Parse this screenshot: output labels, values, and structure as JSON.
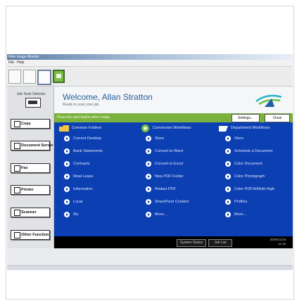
{
  "window": {
    "title": "Web Image Monitor",
    "menu": [
      "File",
      "Help"
    ]
  },
  "sidebar": {
    "title": "Job Tools Selector",
    "buttons": [
      "Copy",
      "Document Server",
      "Fax",
      "Printer",
      "Scanner",
      "Other Function"
    ]
  },
  "header": {
    "welcome": "Welcome, Allan Stratton",
    "subtitle": "Ready to scan your job."
  },
  "bar": {
    "message": "Press the start button when ready.",
    "settings": "Settings...",
    "close": "Close"
  },
  "columns": [
    {
      "title": "Common Folders",
      "items": [
        "Current Desktop",
        "Bank Statements",
        "Contracts",
        "Meal Lease",
        "Information",
        "Local",
        "My"
      ]
    },
    {
      "title": "Conversion Workflows",
      "items": [
        "Store",
        "Convert to Word",
        "Convert to Excel",
        "New PDF Folder",
        "Redact PDF",
        "SharePoint Content",
        "More..."
      ]
    },
    {
      "title": "Department Workflows",
      "items": [
        "Store",
        "Schedule a Document",
        "Color Document",
        "Color Photograph",
        "Color PDF/A/Multi High",
        "Profiles",
        "More..."
      ]
    }
  ],
  "status": {
    "system_status": "System Status",
    "job_list": "Job List",
    "date": "2009/11/18",
    "time": "11:18"
  },
  "colors": {
    "accent_blue": "#0c3fb2",
    "bar_green": "#7bb23d",
    "title_blue": "#2a5e9b"
  }
}
